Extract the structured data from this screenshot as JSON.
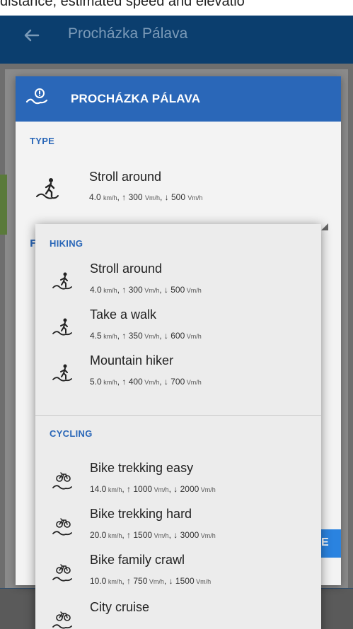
{
  "caption": "distance, estimated speed and elevatio",
  "app_bar": {
    "back_icon": "arrow-left-icon",
    "title": "Procházka Pálava"
  },
  "dialog": {
    "icon": "route-profile-icon",
    "title": "PROCHÁZKA PÁLAVA",
    "type_label": "TYPE",
    "selected": {
      "icon": "hiker-icon",
      "name": "Stroll around",
      "speed": "4.0",
      "uphill": "300",
      "downhill": "500"
    },
    "stub_letter": "F",
    "apply_button": "E"
  },
  "units": {
    "speed": "km/h",
    "vertical": "Vm/h"
  },
  "symbols": {
    "up": "↑",
    "down": "↓"
  },
  "popup": {
    "sections": [
      {
        "label": "HIKING",
        "items": [
          {
            "name": "Stroll around",
            "speed": "4.0",
            "uphill": "300",
            "downhill": "500",
            "icon": "hiker-icon"
          },
          {
            "name": "Take a walk",
            "speed": "4.5",
            "uphill": "350",
            "downhill": "600",
            "icon": "hiker-icon"
          },
          {
            "name": "Mountain hiker",
            "speed": "5.0",
            "uphill": "400",
            "downhill": "700",
            "icon": "hiker-icon"
          }
        ]
      },
      {
        "label": "CYCLING",
        "items": [
          {
            "name": "Bike trekking easy",
            "speed": "14.0",
            "uphill": "1000",
            "downhill": "2000",
            "icon": "bicycle-icon"
          },
          {
            "name": "Bike trekking hard",
            "speed": "20.0",
            "uphill": "1500",
            "downhill": "3000",
            "icon": "bicycle-icon"
          },
          {
            "name": "Bike family crawl",
            "speed": "10.0",
            "uphill": "750",
            "downhill": "1500",
            "icon": "bicycle-icon"
          },
          {
            "name": "City cruise",
            "icon": "bicycle-icon"
          }
        ]
      }
    ]
  },
  "colors": {
    "app_bar": "#0b3e6e",
    "accent": "#2a67b8",
    "button": "#2a83e0"
  }
}
